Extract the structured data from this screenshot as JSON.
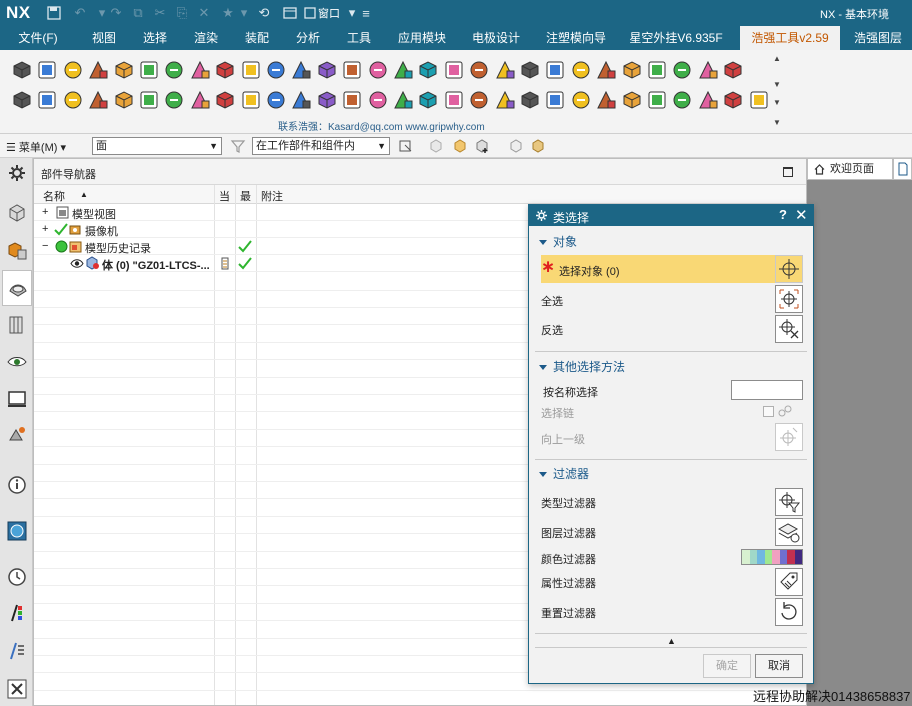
{
  "app": {
    "logo": "NX",
    "title": "NX - 基本环境",
    "window_menu": "窗口"
  },
  "menu": [
    {
      "label": "文件(F)"
    },
    {
      "label": "视图"
    },
    {
      "label": "选择"
    },
    {
      "label": "渲染"
    },
    {
      "label": "装配"
    },
    {
      "label": "分析"
    },
    {
      "label": "工具"
    },
    {
      "label": "应用模块"
    },
    {
      "label": "电极设计"
    },
    {
      "label": "注塑模向导"
    },
    {
      "label": "星空外挂V6.935F"
    },
    {
      "label": "浩强工具v2.59"
    },
    {
      "label": "浩强图层"
    }
  ],
  "ribbon": {
    "contact": "联系浩强：Kasard@qq.com  www.gripwhy.com"
  },
  "selection_bar": {
    "menu": "菜单(M)",
    "type_filter": "面",
    "scope": "在工作部件和组件内"
  },
  "navigator": {
    "title": "部件导航器",
    "columns": {
      "name": "名称",
      "current": "当",
      "latest": "最",
      "note": "附注"
    },
    "rows": [
      {
        "label": "模型视图"
      },
      {
        "label": "摄像机"
      },
      {
        "label": "模型历史记录"
      },
      {
        "label": "体 (0) \"GZ01-LTCS-..."
      }
    ]
  },
  "right_tab": {
    "label": "欢迎页面"
  },
  "dialog": {
    "title": "类选择",
    "help": "?",
    "close": "✕",
    "object_section": "对象",
    "select_object": "选择对象 (0)",
    "select_all": "全选",
    "invert": "反选",
    "other_section": "其他选择方法",
    "by_name": "按名称选择",
    "chain": "选择链",
    "up_level": "向上一级",
    "filter_section": "过滤器",
    "type_filter": "类型过滤器",
    "layer_filter": "图层过滤器",
    "color_filter": "颜色过滤器",
    "attr_filter": "属性过滤器",
    "reset_filter": "重置过滤器",
    "ok": "确定",
    "cancel": "取消"
  },
  "footer": {
    "text": "远程协助解决01438658837"
  },
  "colors": {
    "title_bar": "#1c6685",
    "highlight": "#f9d875",
    "active_tab_text": "#c25700"
  }
}
